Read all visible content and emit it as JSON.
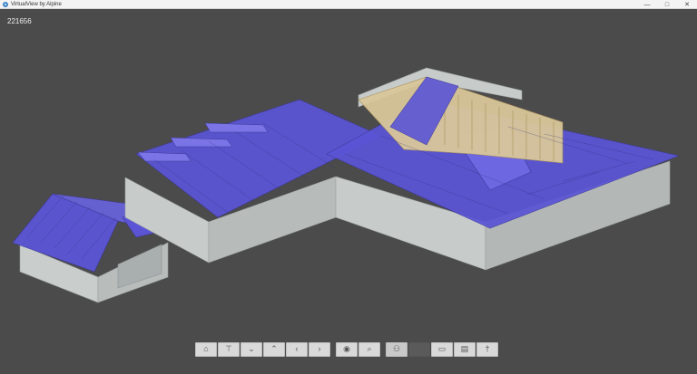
{
  "window": {
    "title": "VirtualView by Alpine",
    "icon": "app-globe-icon",
    "controls": {
      "minimize": "—",
      "maximize": "□",
      "close": "✕"
    }
  },
  "viewer": {
    "job_number": "221656",
    "background_color": "#4b4b4b",
    "truss_color": "#5b55d6",
    "lumber_color": "#d9c79a",
    "wall_color": "#c7cccb"
  },
  "toolbar": {
    "buttons": [
      {
        "icon": "home-icon",
        "glyph": "⌂"
      },
      {
        "icon": "top-view-icon",
        "glyph": "⊤"
      },
      {
        "icon": "chevron-down-icon",
        "glyph": "⌄"
      },
      {
        "icon": "chevron-up-icon",
        "glyph": "⌃"
      },
      {
        "icon": "chevron-left-icon",
        "glyph": "‹"
      },
      {
        "icon": "chevron-right-icon",
        "glyph": "›"
      },
      {
        "icon": "eye-icon",
        "glyph": "◉"
      },
      {
        "icon": "zoom-icon",
        "glyph": "⌕"
      },
      {
        "icon": "person-icon",
        "glyph": "⚇"
      },
      {
        "icon": "blank-icon",
        "glyph": ""
      },
      {
        "icon": "plan-view-icon",
        "glyph": "▭"
      },
      {
        "icon": "elevation-view-icon",
        "glyph": "▤"
      },
      {
        "icon": "walk-icon",
        "glyph": "†"
      }
    ]
  }
}
